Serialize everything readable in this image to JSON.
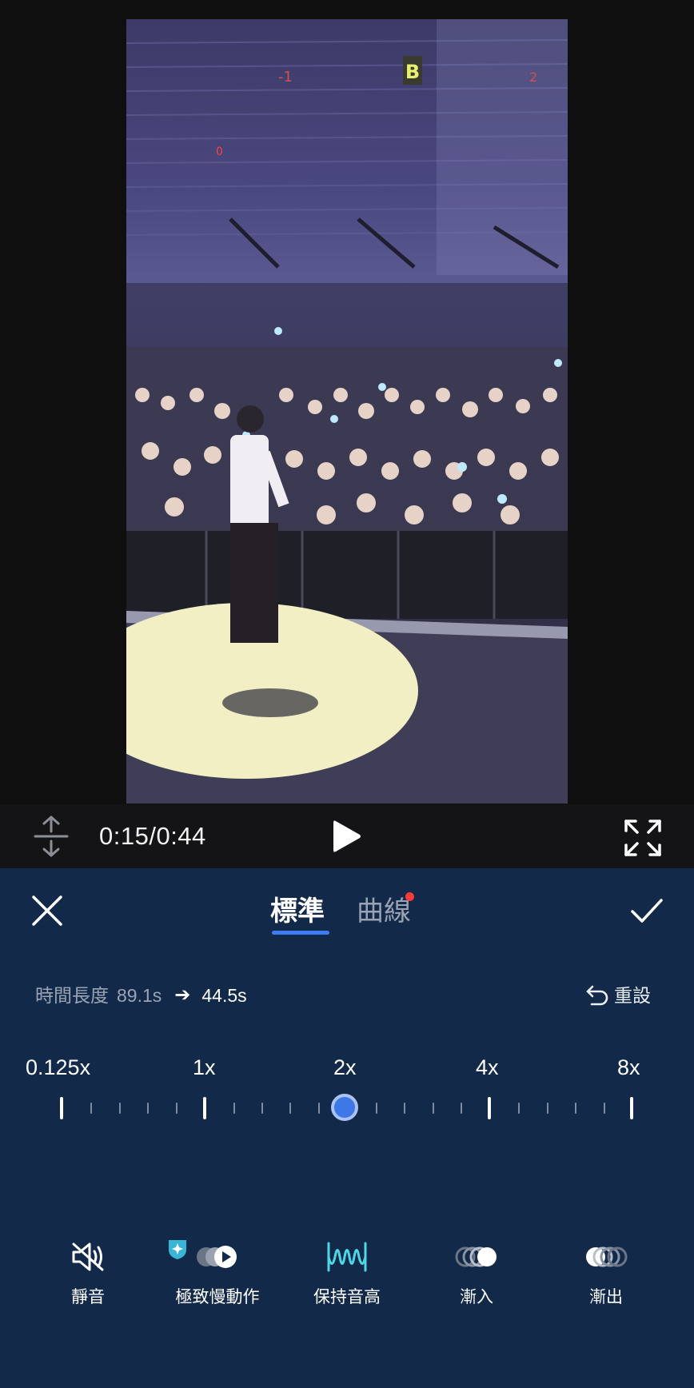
{
  "player": {
    "time": "0:15/0:44"
  },
  "tabs": [
    {
      "label": "標準",
      "active": true
    },
    {
      "label": "曲線",
      "active": false,
      "has_dot": true
    }
  ],
  "duration": {
    "label": "時間長度",
    "original": "89.1s",
    "arrow": "➔",
    "new": "44.5s"
  },
  "reset_label": "重設",
  "speed": {
    "labels": [
      "0.125x",
      "1x",
      "2x",
      "4x",
      "8x"
    ],
    "selected": "2x"
  },
  "tools": [
    {
      "label": "靜音",
      "icon": "mute-icon"
    },
    {
      "label": "極致慢動作",
      "icon": "super-slow-motion-icon"
    },
    {
      "label": "保持音高",
      "icon": "waveform-icon"
    },
    {
      "label": "漸入",
      "icon": "fade-in-icon"
    },
    {
      "label": "漸出",
      "icon": "fade-out-icon"
    }
  ],
  "colors": {
    "panel_bg": "#13294a",
    "accent": "#3f7cf5",
    "waveform": "#4fd6e4",
    "dot": "#ff3b3b"
  }
}
